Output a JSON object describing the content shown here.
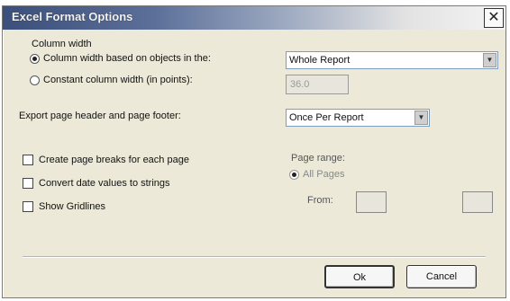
{
  "dialog": {
    "title": "Excel Format Options",
    "close_glyph": "✕"
  },
  "column_width": {
    "group_label": "Column width",
    "option_report": "Column width based on objects in the:",
    "option_constant": "Constant column width (in points):",
    "report_select_value": "Whole Report",
    "constant_value": "36.0"
  },
  "headers": {
    "label": "Export page header and page footer:",
    "select_value": "Once Per Report"
  },
  "options": {
    "page_breaks": "Create page breaks for each page",
    "convert_dates": "Convert date values to strings",
    "show_gridlines": "Show Gridlines"
  },
  "page_range": {
    "label": "Page range:",
    "all_label": "All Pages",
    "from_label": "From:"
  },
  "buttons": {
    "ok": "Ok",
    "cancel": "Cancel"
  }
}
